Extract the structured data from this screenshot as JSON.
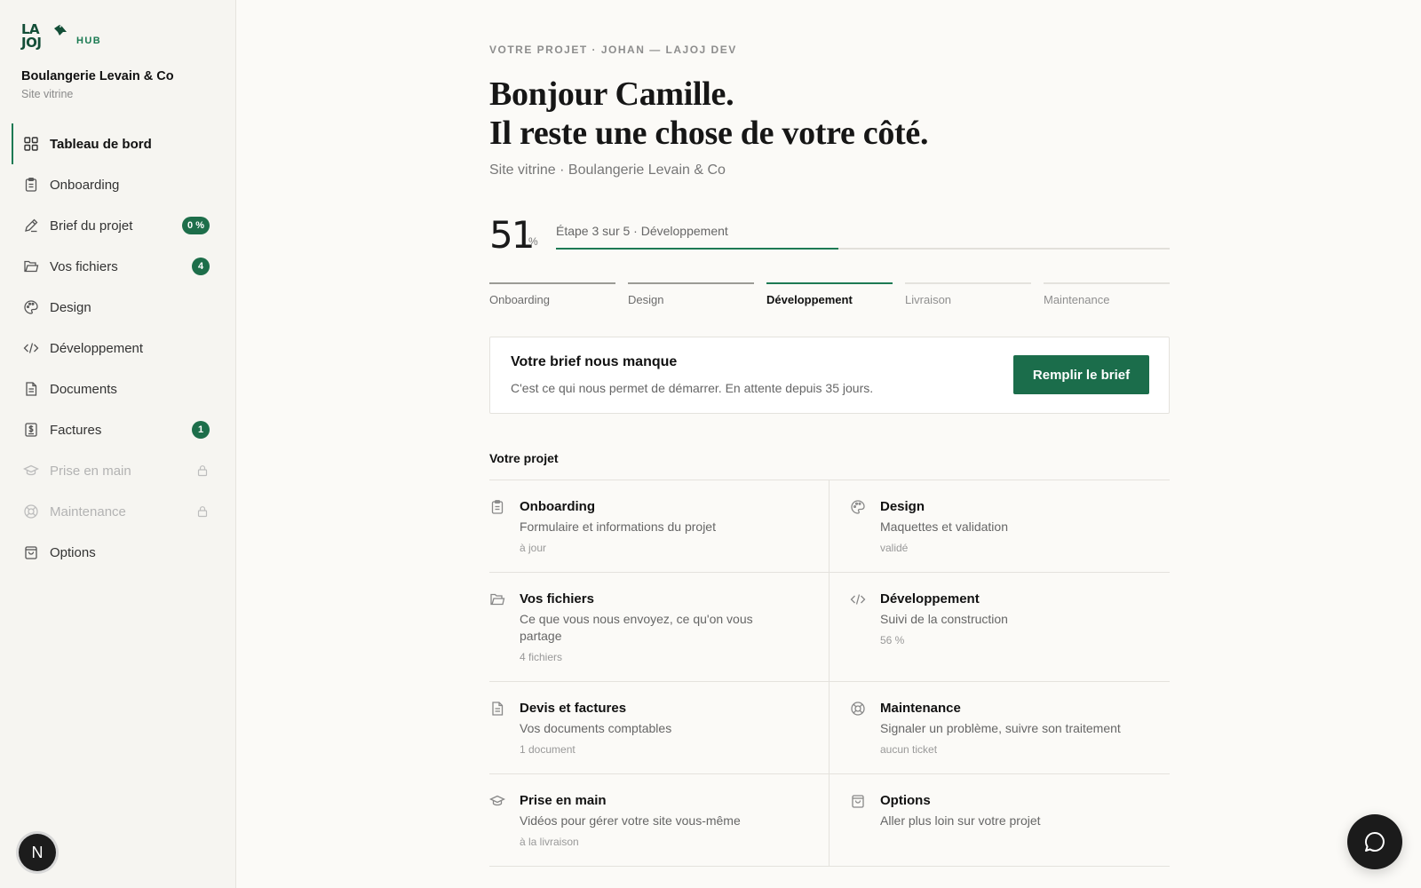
{
  "brand": {
    "logo_line1": "LA",
    "logo_line2": "JOJ",
    "hub": "HUB"
  },
  "client": {
    "name": "Boulangerie Levain & Co",
    "type": "Site vitrine"
  },
  "sidebar": {
    "items": [
      {
        "label": "Tableau de bord",
        "icon": "grid-icon",
        "active": true
      },
      {
        "label": "Onboarding",
        "icon": "clipboard-icon"
      },
      {
        "label": "Brief du projet",
        "icon": "pencil-icon",
        "badge": "0 %"
      },
      {
        "label": "Vos fichiers",
        "icon": "folder-icon",
        "badge": "4"
      },
      {
        "label": "Design",
        "icon": "palette-icon"
      },
      {
        "label": "Développement",
        "icon": "code-icon"
      },
      {
        "label": "Documents",
        "icon": "document-icon"
      },
      {
        "label": "Factures",
        "icon": "invoice-icon",
        "badge": "1"
      },
      {
        "label": "Prise en main",
        "icon": "graduation-cap-icon",
        "locked": true
      },
      {
        "label": "Maintenance",
        "icon": "lifebuoy-icon",
        "locked": true
      },
      {
        "label": "Options",
        "icon": "shopping-bag-icon"
      }
    ],
    "user_initial": "N"
  },
  "header": {
    "eyebrow": "VOTRE PROJET · JOHAN — LAJOJ DEV",
    "headline_line1": "Bonjour Camille.",
    "headline_line2": "Il reste une chose de votre côté.",
    "subline": "Site vitrine · Boulangerie Levain & Co"
  },
  "progress": {
    "percent": 51,
    "percent_text": "51",
    "percent_sign": "%",
    "step_label": "Étape 3 sur 5 · Développement",
    "fill_fraction": 0.46
  },
  "stages": [
    {
      "label": "Onboarding",
      "state": "done"
    },
    {
      "label": "Design",
      "state": "done"
    },
    {
      "label": "Développement",
      "state": "current"
    },
    {
      "label": "Livraison",
      "state": "todo"
    },
    {
      "label": "Maintenance",
      "state": "todo"
    }
  ],
  "alert": {
    "title": "Votre brief nous manque",
    "text": "C'est ce qui nous permet de démarrer. En attente depuis 35 jours.",
    "button": "Remplir le brief"
  },
  "project": {
    "title": "Votre projet",
    "cards": [
      {
        "title": "Onboarding",
        "desc": "Formulaire et informations du projet",
        "meta": "à jour",
        "icon": "clipboard-icon"
      },
      {
        "title": "Design",
        "desc": "Maquettes et validation",
        "meta": "validé",
        "icon": "palette-icon"
      },
      {
        "title": "Vos fichiers",
        "desc": "Ce que vous nous envoyez, ce qu'on vous partage",
        "meta": "4 fichiers",
        "icon": "folder-icon"
      },
      {
        "title": "Développement",
        "desc": "Suivi de la construction",
        "meta": "56 %",
        "icon": "code-icon"
      },
      {
        "title": "Devis et factures",
        "desc": "Vos documents comptables",
        "meta": "1 document",
        "icon": "document-icon"
      },
      {
        "title": "Maintenance",
        "desc": "Signaler un problème, suivre son traitement",
        "meta": "aucun ticket",
        "icon": "lifebuoy-icon"
      },
      {
        "title": "Prise en main",
        "desc": "Vidéos pour gérer votre site vous-même",
        "meta": "à la livraison",
        "icon": "graduation-cap-icon"
      },
      {
        "title": "Options",
        "desc": "Aller plus loin sur votre projet",
        "meta": "",
        "icon": "shopping-bag-icon"
      }
    ]
  },
  "colors": {
    "accent": "#1d7a54",
    "button": "#1b6d4b",
    "badge": "#1d6e4a"
  }
}
